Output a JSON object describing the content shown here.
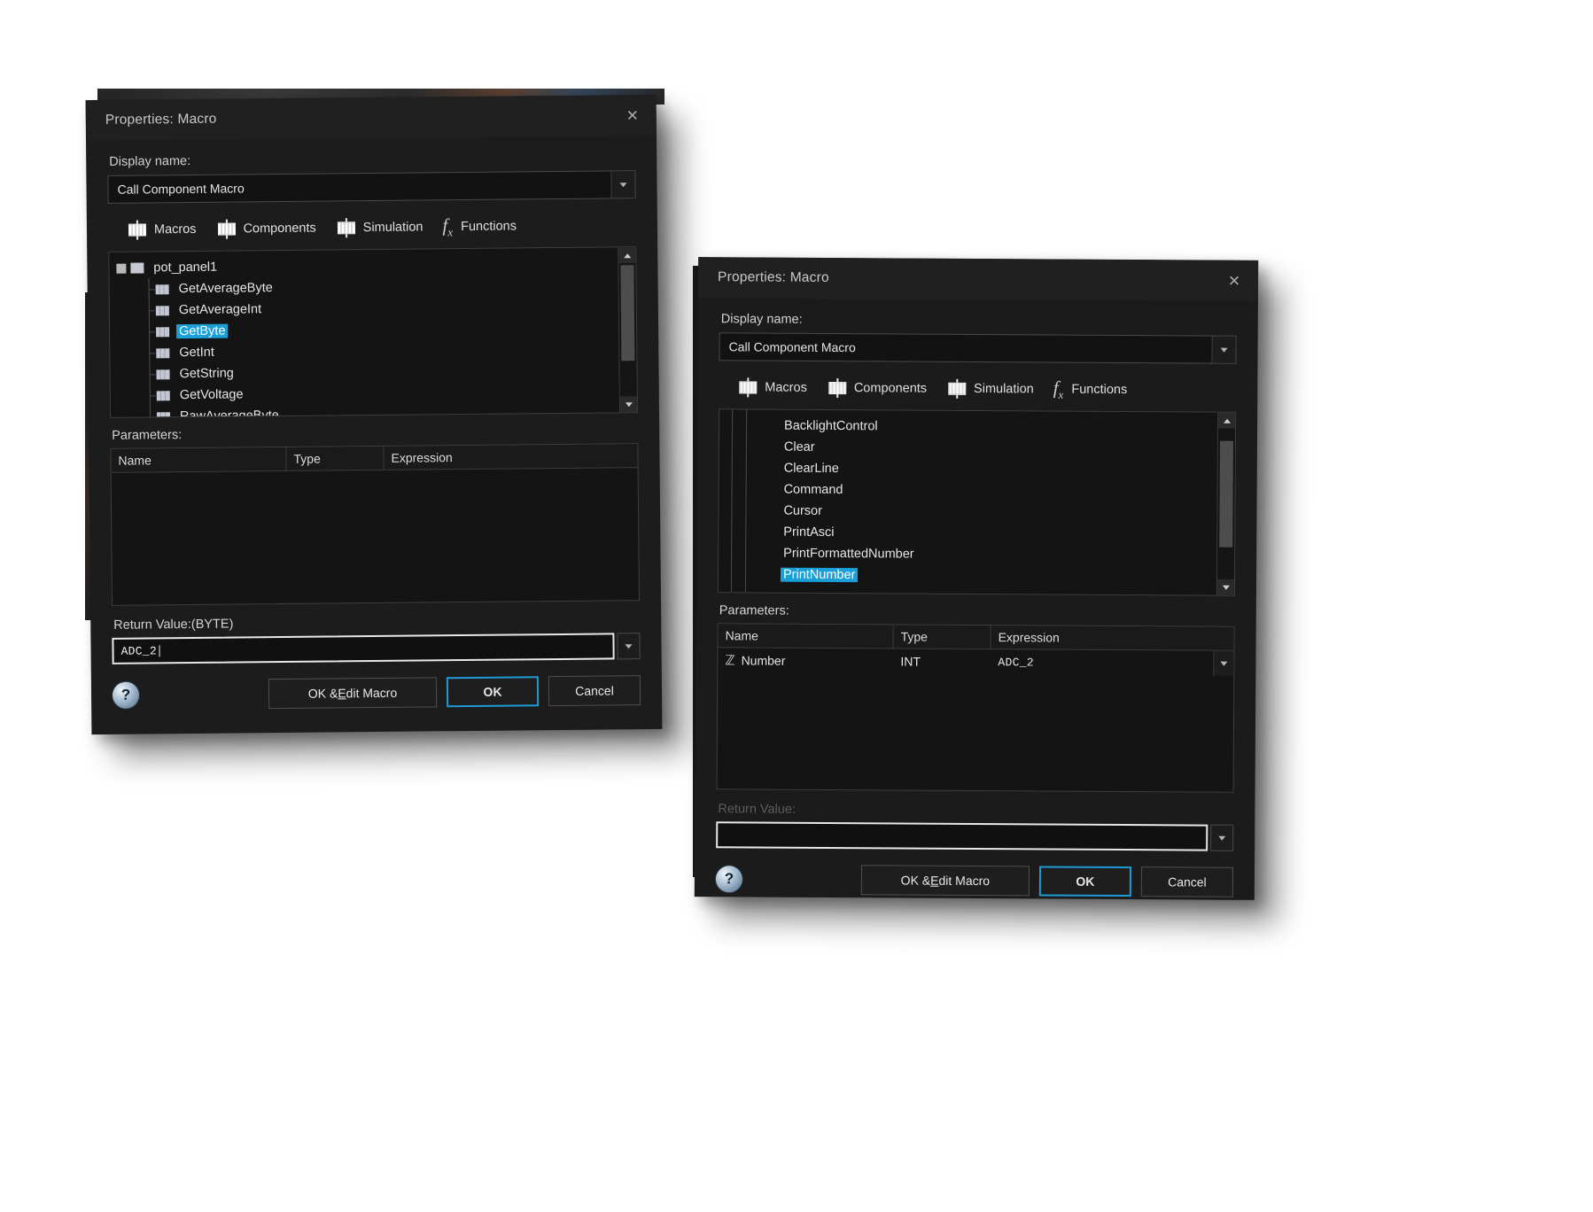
{
  "dialog1": {
    "title": "Properties: Macro",
    "close_icon": "close-icon",
    "display_name_label": "Display name:",
    "display_name_value": "Call Component Macro",
    "tabs": [
      {
        "label": "Macros",
        "icon": "component-chip-icon"
      },
      {
        "label": "Components",
        "icon": "component-chip-icon"
      },
      {
        "label": "Simulation",
        "icon": "component-chip-icon"
      },
      {
        "label": "Functions",
        "icon": "fx-icon"
      }
    ],
    "tree": {
      "root": "pot_panel1",
      "items": [
        {
          "label": "GetAverageByte",
          "selected": false
        },
        {
          "label": "GetAverageInt",
          "selected": false
        },
        {
          "label": "GetByte",
          "selected": true
        },
        {
          "label": "GetInt",
          "selected": false
        },
        {
          "label": "GetString",
          "selected": false
        },
        {
          "label": "GetVoltage",
          "selected": false
        },
        {
          "label": "RawAverageByte",
          "selected": false
        }
      ]
    },
    "parameters_label": "Parameters:",
    "columns": [
      "Name",
      "Type",
      "Expression"
    ],
    "rows": [],
    "return_value_label": "Return Value:(BYTE)",
    "return_value": "ADC_2",
    "buttons": {
      "help": "?",
      "ok_edit_macro": "OK & Edit Macro",
      "ok_edit_macro_pre": "OK & ",
      "ok_edit_macro_key": "E",
      "ok_edit_macro_post": "dit Macro",
      "ok": "OK",
      "cancel": "Cancel"
    }
  },
  "dialog2": {
    "title": "Properties: Macro",
    "close_icon": "close-icon",
    "display_name_label": "Display name:",
    "display_name_value": "Call Component Macro",
    "tabs": [
      {
        "label": "Macros",
        "icon": "component-chip-icon"
      },
      {
        "label": "Components",
        "icon": "component-chip-icon"
      },
      {
        "label": "Simulation",
        "icon": "component-chip-icon"
      },
      {
        "label": "Functions",
        "icon": "fx-icon"
      }
    ],
    "tree": {
      "root": "",
      "items": [
        {
          "label": "BacklightControl",
          "selected": false
        },
        {
          "label": "Clear",
          "selected": false
        },
        {
          "label": "ClearLine",
          "selected": false
        },
        {
          "label": "Command",
          "selected": false
        },
        {
          "label": "Cursor",
          "selected": false
        },
        {
          "label": "PrintAsci",
          "selected": false
        },
        {
          "label": "PrintFormattedNumber",
          "selected": false
        },
        {
          "label": "PrintNumber",
          "selected": true
        }
      ]
    },
    "parameters_label": "Parameters:",
    "columns": [
      "Name",
      "Type",
      "Expression"
    ],
    "rows": [
      {
        "icon": "variable-z-icon",
        "name": "Number",
        "type": "INT",
        "expression": "ADC_2"
      }
    ],
    "return_value_label": "Return Value:",
    "return_value": "",
    "buttons": {
      "help": "?",
      "ok_edit_macro_pre": "OK & ",
      "ok_edit_macro_key": "E",
      "ok_edit_macro_post": "dit Macro",
      "ok": "OK",
      "cancel": "Cancel"
    }
  },
  "colors": {
    "selection_blue": "#1a9fd9",
    "default_button_outline": "#1e9bd4",
    "dialog_background": "#1b1b1b",
    "field_background": "#121212"
  }
}
